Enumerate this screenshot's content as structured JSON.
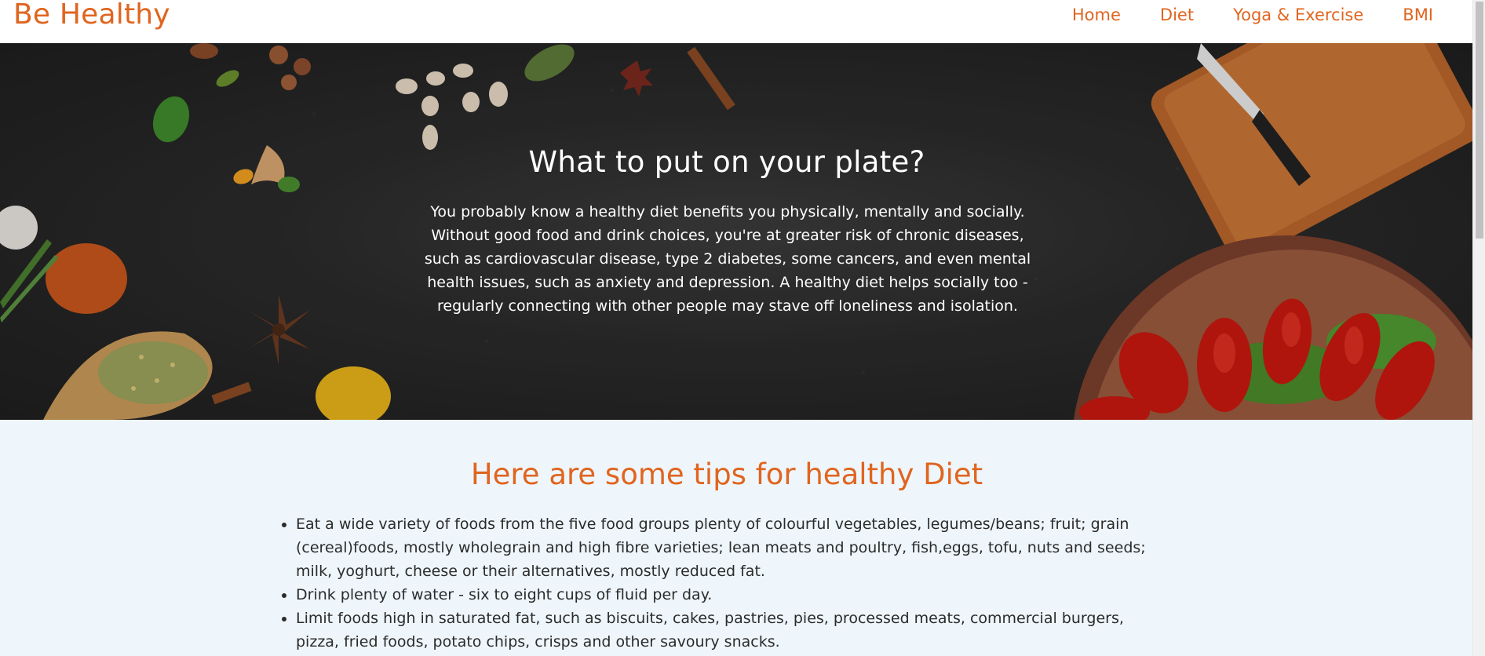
{
  "navbar": {
    "brand": "Be Healthy",
    "links": [
      "Home",
      "Diet",
      "Yoga & Exercise",
      "BMI"
    ]
  },
  "hero": {
    "title": "What to put on your plate?",
    "text": "You probably know a healthy diet benefits you physically, mentally and socially. Without good food and drink choices, you're at greater risk of chronic diseases, such as cardiovascular disease, type 2 diabetes, some cancers, and even mental health issues, such as anxiety and depression. A healthy diet helps socially too - regularly connecting with other people may stave off loneliness and isolation."
  },
  "tips": {
    "title": "Here are some tips for healthy Diet",
    "items": [
      "Eat a wide variety of foods from the five food groups plenty of colourful vegetables, legumes/beans; fruit; grain (cereal)foods, mostly wholegrain and high fibre varieties; lean meats and poultry, fish,eggs, tofu, nuts and seeds; milk, yoghurt, cheese or their alternatives, mostly reduced fat.",
      "Drink plenty of water - six to eight cups of fluid per day.",
      "Limit foods high in saturated fat, such as biscuits, cakes, pastries, pies, processed meats, commercial burgers, pizza, fried foods, potato chips, crisps and other savoury snacks."
    ]
  },
  "colors": {
    "accent": "#e0651f",
    "hero_background": "#2a2a2a",
    "tips_background": "#eef6fb",
    "body_text": "#2b2b2b"
  },
  "icons": [
    "hero-food-image"
  ]
}
